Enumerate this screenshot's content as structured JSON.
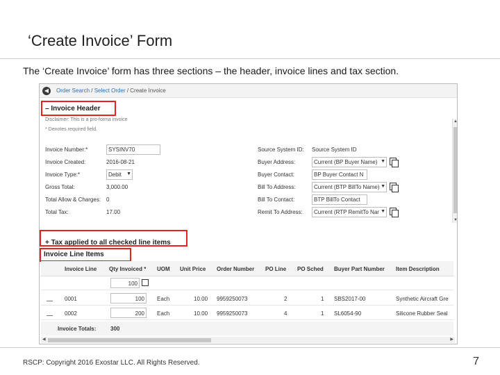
{
  "slide": {
    "title": "‘Create Invoice’ Form",
    "subtitle": "The ‘Create Invoice’ form has three sections – the header, invoice lines and tax section.",
    "footer": "RSCP: Copyright 2016 Exostar LLC. All Rights Reserved.",
    "page_number": "7"
  },
  "breadcrumb": {
    "order_search": "Order Search",
    "sep1": " / ",
    "select_order": "Select Order",
    "sep2": " / ",
    "current": "Create Invoice"
  },
  "header_section": {
    "title": "– Invoice Header",
    "disclaimer": "Disclaimer: This is a pro-forma invoice",
    "denotes": "* Denotes required field.",
    "left_fields": [
      {
        "label": "Invoice Number:*",
        "value": "SYSINV70"
      },
      {
        "label": "Invoice Created:",
        "value": "2016-08-21"
      },
      {
        "label": "Invoice Type:*",
        "value": "Debit"
      },
      {
        "label": "Gross Total:",
        "value": "3,000.00"
      },
      {
        "label": "Total Allow & Charges:",
        "value": "0"
      },
      {
        "label": "Total Tax:",
        "value": "17.00"
      }
    ],
    "right_fields": [
      {
        "label": "Source System ID:",
        "value": "Source System ID"
      },
      {
        "label": "Buyer Address:",
        "value": "Current (BP Buyer Name)"
      },
      {
        "label": "Buyer Contact:",
        "value": "BP Buyer Contact N"
      },
      {
        "label": "Bill To Address:",
        "value": "Current (BTP BillTo Name)"
      },
      {
        "label": "Bill To Contact:",
        "value": "BTP BillTo Contact"
      },
      {
        "label": "Remit To Address:",
        "value": "Current (RTP RemitTo Nar"
      }
    ]
  },
  "tax_section": {
    "label": "+ Tax applied to all checked line items"
  },
  "lines_section": {
    "title": "Invoice Line Items",
    "columns": [
      "Invoice Line",
      "Qty Invoiced *",
      "UOM",
      "Unit Price",
      "Order Number",
      "PO Line",
      "PO Sched",
      "Buyer Part Number",
      "Item Description"
    ],
    "filter_qty": "100",
    "rows": [
      {
        "line": "0001",
        "qty": "100",
        "uom": "Each",
        "price": "10.00",
        "order": "9959250073",
        "po_line": "2",
        "po_sched": "1",
        "part": "SBS2017-00",
        "desc": "Synthetic Aircraft Gre"
      },
      {
        "line": "0002",
        "qty": "200",
        "uom": "Each",
        "price": "10.00",
        "order": "9959250073",
        "po_line": "4",
        "po_sched": "1",
        "part": "SL6054-90",
        "desc": "Silicone Rubber Seal"
      }
    ],
    "totals_label": "Invoice Totals:",
    "totals_qty": "300"
  },
  "colors": {
    "highlight": "#e2241b",
    "link": "#2a6fb3"
  }
}
